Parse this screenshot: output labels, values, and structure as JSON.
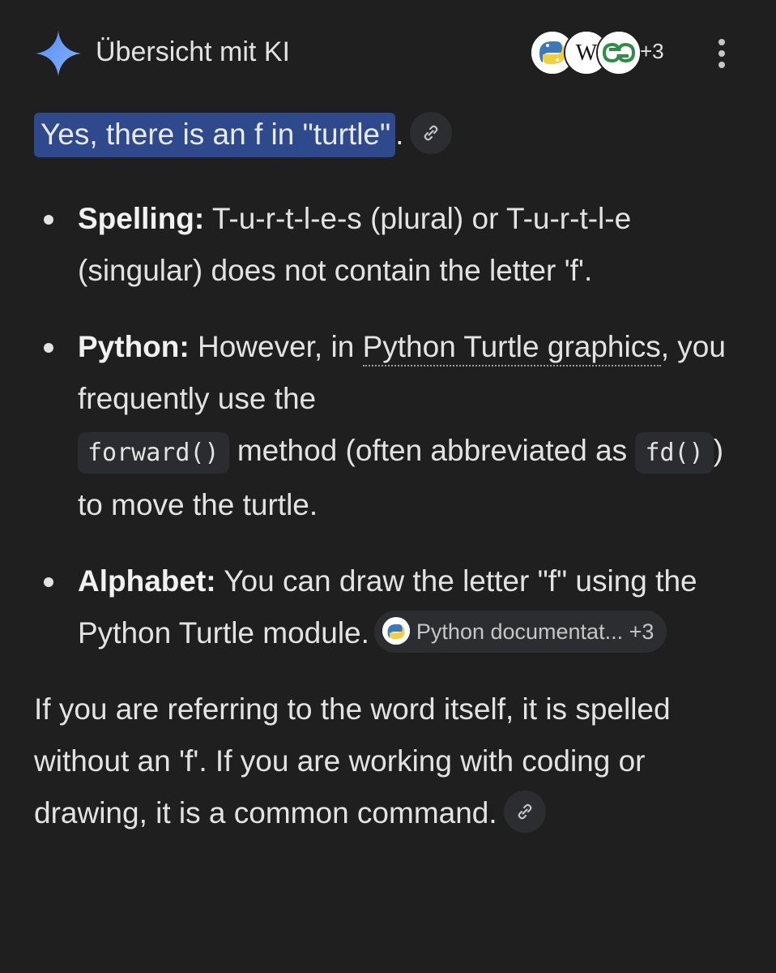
{
  "header": {
    "title": "Übersicht mit KI",
    "more_sources": "+3",
    "sources": [
      {
        "icon": "python-logo-icon"
      },
      {
        "icon": "wikipedia-logo-icon"
      },
      {
        "icon": "geeksforgeeks-logo-icon"
      }
    ],
    "accent_color": "#2e4a8c"
  },
  "answer": {
    "lead_highlight": "Yes, there is an f in \"turtle\"",
    "lead_tail": ".",
    "bullets": [
      {
        "label": "Spelling:",
        "text": " T-u-r-t-l-e-s (plural) or T-u-r-t-l-e (singular) does not contain the letter 'f'."
      },
      {
        "label": "Python:",
        "text_before": " However, in ",
        "link": "Python Turtle graphics",
        "text_mid": ", you frequently use the ",
        "code1": "forward()",
        "text_mid2": " method (often abbreviated as ",
        "code2": "fd()",
        "text_after": ") to move the turtle."
      },
      {
        "label": "Alphabet:",
        "text": " You can draw the letter \"f\" using the Python Turtle module.",
        "source_chip": "Python documentat... +3"
      }
    ],
    "closing": "If you are referring to the word itself, it is spelled without an 'f'. If you are working with coding or drawing, it is a common command."
  }
}
